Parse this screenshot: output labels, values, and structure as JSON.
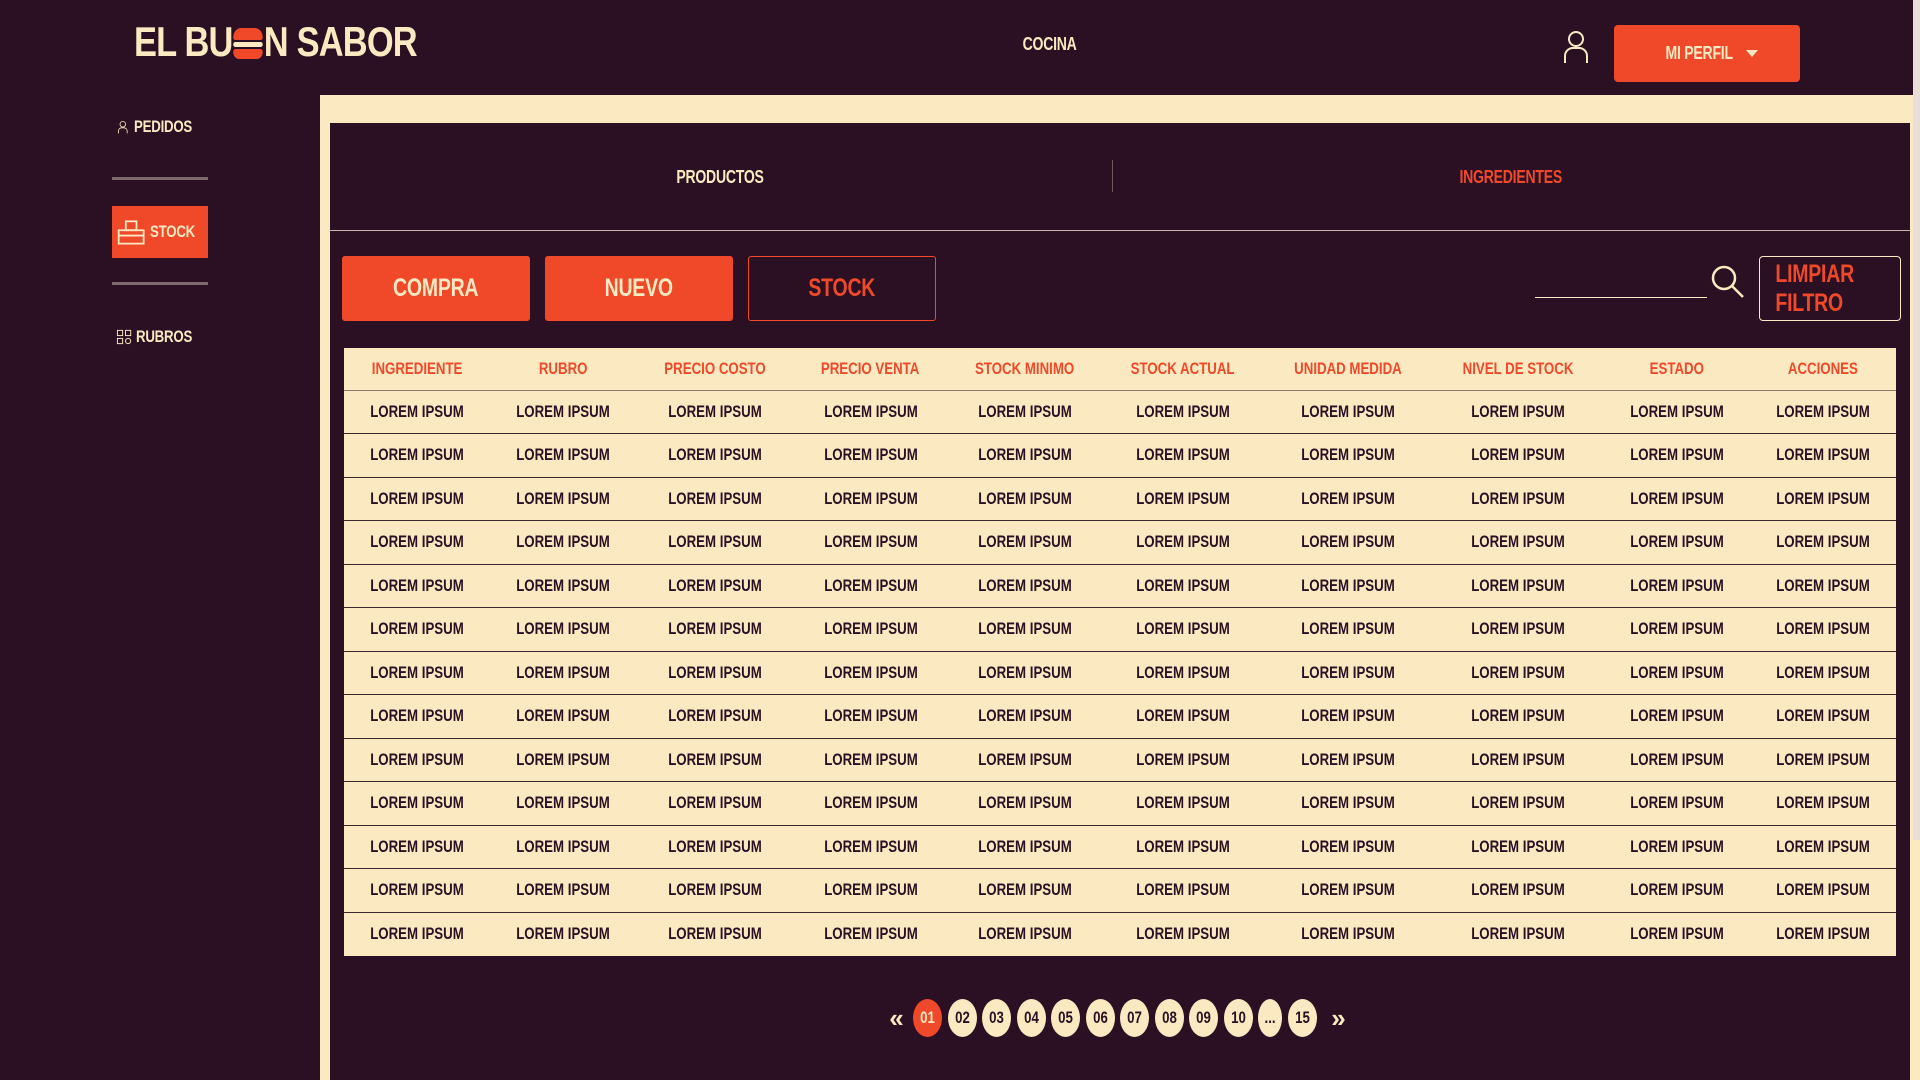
{
  "header": {
    "logo_text_left": "EL BU",
    "logo_text_right": "N SABOR",
    "nav_center": "COCINA",
    "profile_label": "MI PERFIL"
  },
  "sidebar": {
    "items": [
      {
        "label": "PEDIDOS",
        "icon": "user-icon"
      },
      {
        "label": "STOCK",
        "icon": "stock-icon",
        "active": true
      },
      {
        "label": "RUBROS",
        "icon": "grid-icon"
      }
    ]
  },
  "tabs": [
    {
      "label": "PRODUCTOS"
    },
    {
      "label": "INGREDIENTES",
      "active": true
    }
  ],
  "toolbar": {
    "compra": "COMPRA",
    "nuevo": "NUEVO",
    "stock": "STOCK",
    "search_value": "",
    "clear": "LIMPIAR FILTRO"
  },
  "table": {
    "columns": [
      "INGREDIENTE",
      "RUBRO",
      "PRECIO COSTO",
      "PRECIO VENTA",
      "STOCK MINIMO",
      "STOCK ACTUAL",
      "UNIDAD MEDIDA",
      "NIVEL DE STOCK",
      "ESTADO",
      "ACCIONES"
    ],
    "rows": [
      [
        "LOREM IPSUM",
        "LOREM IPSUM",
        "LOREM IPSUM",
        "LOREM IPSUM",
        "LOREM IPSUM",
        "LOREM IPSUM",
        "LOREM IPSUM",
        "LOREM IPSUM",
        "LOREM IPSUM",
        "LOREM IPSUM"
      ],
      [
        "LOREM IPSUM",
        "LOREM IPSUM",
        "LOREM IPSUM",
        "LOREM IPSUM",
        "LOREM IPSUM",
        "LOREM IPSUM",
        "LOREM IPSUM",
        "LOREM IPSUM",
        "LOREM IPSUM",
        "LOREM IPSUM"
      ],
      [
        "LOREM IPSUM",
        "LOREM IPSUM",
        "LOREM IPSUM",
        "LOREM IPSUM",
        "LOREM IPSUM",
        "LOREM IPSUM",
        "LOREM IPSUM",
        "LOREM IPSUM",
        "LOREM IPSUM",
        "LOREM IPSUM"
      ],
      [
        "LOREM IPSUM",
        "LOREM IPSUM",
        "LOREM IPSUM",
        "LOREM IPSUM",
        "LOREM IPSUM",
        "LOREM IPSUM",
        "LOREM IPSUM",
        "LOREM IPSUM",
        "LOREM IPSUM",
        "LOREM IPSUM"
      ],
      [
        "LOREM IPSUM",
        "LOREM IPSUM",
        "LOREM IPSUM",
        "LOREM IPSUM",
        "LOREM IPSUM",
        "LOREM IPSUM",
        "LOREM IPSUM",
        "LOREM IPSUM",
        "LOREM IPSUM",
        "LOREM IPSUM"
      ],
      [
        "LOREM IPSUM",
        "LOREM IPSUM",
        "LOREM IPSUM",
        "LOREM IPSUM",
        "LOREM IPSUM",
        "LOREM IPSUM",
        "LOREM IPSUM",
        "LOREM IPSUM",
        "LOREM IPSUM",
        "LOREM IPSUM"
      ],
      [
        "LOREM IPSUM",
        "LOREM IPSUM",
        "LOREM IPSUM",
        "LOREM IPSUM",
        "LOREM IPSUM",
        "LOREM IPSUM",
        "LOREM IPSUM",
        "LOREM IPSUM",
        "LOREM IPSUM",
        "LOREM IPSUM"
      ],
      [
        "LOREM IPSUM",
        "LOREM IPSUM",
        "LOREM IPSUM",
        "LOREM IPSUM",
        "LOREM IPSUM",
        "LOREM IPSUM",
        "LOREM IPSUM",
        "LOREM IPSUM",
        "LOREM IPSUM",
        "LOREM IPSUM"
      ],
      [
        "LOREM IPSUM",
        "LOREM IPSUM",
        "LOREM IPSUM",
        "LOREM IPSUM",
        "LOREM IPSUM",
        "LOREM IPSUM",
        "LOREM IPSUM",
        "LOREM IPSUM",
        "LOREM IPSUM",
        "LOREM IPSUM"
      ],
      [
        "LOREM IPSUM",
        "LOREM IPSUM",
        "LOREM IPSUM",
        "LOREM IPSUM",
        "LOREM IPSUM",
        "LOREM IPSUM",
        "LOREM IPSUM",
        "LOREM IPSUM",
        "LOREM IPSUM",
        "LOREM IPSUM"
      ],
      [
        "LOREM IPSUM",
        "LOREM IPSUM",
        "LOREM IPSUM",
        "LOREM IPSUM",
        "LOREM IPSUM",
        "LOREM IPSUM",
        "LOREM IPSUM",
        "LOREM IPSUM",
        "LOREM IPSUM",
        "LOREM IPSUM"
      ],
      [
        "LOREM IPSUM",
        "LOREM IPSUM",
        "LOREM IPSUM",
        "LOREM IPSUM",
        "LOREM IPSUM",
        "LOREM IPSUM",
        "LOREM IPSUM",
        "LOREM IPSUM",
        "LOREM IPSUM",
        "LOREM IPSUM"
      ],
      [
        "LOREM IPSUM",
        "LOREM IPSUM",
        "LOREM IPSUM",
        "LOREM IPSUM",
        "LOREM IPSUM",
        "LOREM IPSUM",
        "LOREM IPSUM",
        "LOREM IPSUM",
        "LOREM IPSUM",
        "LOREM IPSUM"
      ]
    ]
  },
  "pagination": {
    "prev": "«",
    "next": "»",
    "pages": [
      "01",
      "02",
      "03",
      "04",
      "05",
      "06",
      "07",
      "08",
      "09",
      "10",
      "...",
      "15"
    ],
    "active": "01"
  },
  "colors": {
    "background": "#2b1024",
    "accent": "#f0492a",
    "cream": "#fbe9c1"
  }
}
